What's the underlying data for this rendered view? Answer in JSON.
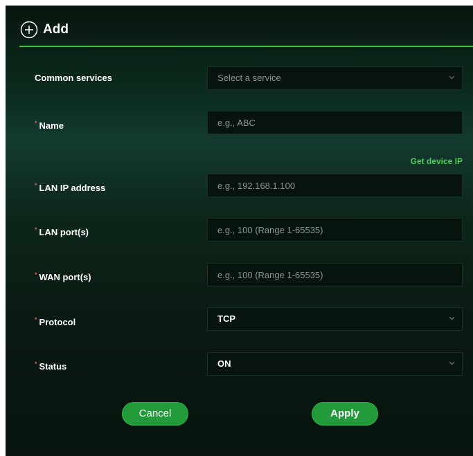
{
  "header": {
    "title": "Add",
    "icon": "plus-circle-icon"
  },
  "form": {
    "common_services": {
      "label": "Common services",
      "placeholder": "Select a service"
    },
    "name": {
      "required_mark": "*",
      "label": "Name",
      "placeholder": "e.g., ABC"
    },
    "get_device_ip": "Get device IP",
    "lan_ip": {
      "required_mark": "*",
      "label": "LAN IP address",
      "placeholder": "e.g., 192.168.1.100"
    },
    "lan_ports": {
      "required_mark": "*",
      "label": "LAN port(s)",
      "placeholder": "e.g., 100 (Range 1-65535)"
    },
    "wan_ports": {
      "required_mark": "*",
      "label": "WAN port(s)",
      "placeholder": "e.g., 100 (Range 1-65535)"
    },
    "protocol": {
      "required_mark": "*",
      "label": "Protocol",
      "value": "TCP"
    },
    "status": {
      "required_mark": "*",
      "label": "Status",
      "value": "ON"
    }
  },
  "buttons": {
    "cancel": "Cancel",
    "apply": "Apply"
  },
  "colors": {
    "accent": "#35c746",
    "button": "#239a3a",
    "required": "#e05560"
  }
}
